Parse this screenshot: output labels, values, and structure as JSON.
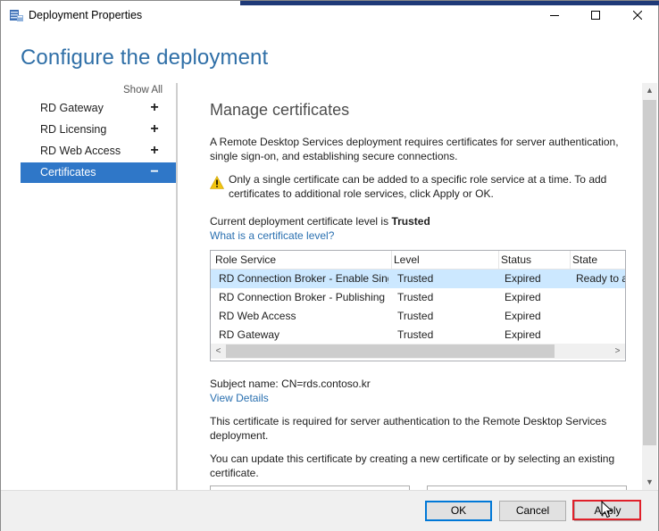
{
  "window": {
    "title": "Deployment Properties"
  },
  "heading": "Configure the deployment",
  "sidebar": {
    "show_all": "Show All",
    "items": [
      {
        "label": "RD Gateway",
        "sign": "+"
      },
      {
        "label": "RD Licensing",
        "sign": "+"
      },
      {
        "label": "RD Web Access",
        "sign": "+"
      },
      {
        "label": "Certificates",
        "sign": "−"
      }
    ],
    "selected": "Certificates"
  },
  "content": {
    "title": "Manage certificates",
    "intro": "A Remote Desktop Services deployment requires certificates for server authentication, single sign-on, and establishing secure connections.",
    "warning": "Only a single certificate can be added to a specific role service at a time. To add certificates to additional role services, click Apply or OK.",
    "level_label": "Current deployment certificate level is",
    "level_value": "Trusted",
    "level_link": "What is a certificate level?",
    "table": {
      "headers": [
        "Role Service",
        "Level",
        "Status",
        "State"
      ],
      "rows": [
        [
          "RD Connection Broker - Enable Single Sign On",
          "Trusted",
          "Expired",
          "Ready to apply"
        ],
        [
          "RD Connection Broker - Publishing",
          "Trusted",
          "Expired",
          ""
        ],
        [
          "RD Web Access",
          "Trusted",
          "Expired",
          ""
        ],
        [
          "RD Gateway",
          "Trusted",
          "Expired",
          ""
        ]
      ]
    },
    "subject_label": "Subject name:",
    "subject_value": "CN=rds.contoso.kr",
    "view_details": "View Details",
    "required_text": "This certificate is required for server authentication to the Remote Desktop Services deployment.",
    "update_text": "You can update this certificate by creating a new certificate or by selecting an existing certificate."
  },
  "footer": {
    "ok": "OK",
    "cancel": "Cancel",
    "apply": "Apply"
  },
  "colors": {
    "heading": "#2f6fa7",
    "selected_nav": "#2f77c8",
    "link": "#2a70b0",
    "highlight": "#e0202a"
  }
}
